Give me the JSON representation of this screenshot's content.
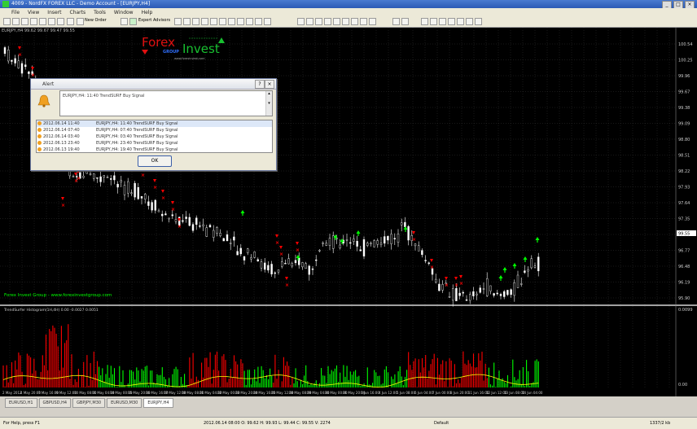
{
  "window": {
    "title": "4009 - NordFX FOREX LLC - Demo Account - [EURJPY,H4]"
  },
  "menu": [
    "File",
    "View",
    "Insert",
    "Charts",
    "Tools",
    "Window",
    "Help"
  ],
  "toolbar": {
    "new_order": "New Order",
    "expert_advisors": "Expert Advisors"
  },
  "chart": {
    "window_label": "EURJPY,H4  99.62 99.67 99.47 99.55",
    "price_ticks": [
      "100.54",
      "100.25",
      "99.96",
      "99.67",
      "99.38",
      "99.09",
      "98.80",
      "98.51",
      "98.22",
      "97.93",
      "97.64",
      "97.35",
      "97.06",
      "96.77",
      "96.48",
      "96.19",
      "95.90"
    ],
    "current_price": "99.55",
    "overlay_note": "Forex Invest Group - www.forexinvestgroup.com",
    "indicator_label": "TrendSurfer Histogram(1H,4H)  0.00  -0.0027  0.0051",
    "indicator_ticks": [
      "0.0099",
      "0.00"
    ],
    "time_labels": [
      "2 May 2012",
      "4 May 20:00",
      "7 May 16:00",
      "9 May 12:00",
      "10 May 08:00",
      "11 May 04:00",
      "14 May 00:00",
      "15 May 20:00",
      "16 May 16:00",
      "17 May 12:00",
      "18 May 08:00",
      "21 May 04:00",
      "22 May 00:00",
      "23 May 20:00",
      "24 May 16:00",
      "25 May 12:00",
      "28 May 08:00",
      "29 May 04:00",
      "30 May 00:00",
      "31 May 20:00",
      "1 Jun 16:00",
      "4 Jun 12:00",
      "5 Jun 08:00",
      "6 Jun 04:00",
      "7 Jun 00:00",
      "8 Jun 20:00",
      "11 Jun 16:00",
      "12 Jun 12:00",
      "13 Jun 08:00",
      "14 Jun 04:00"
    ]
  },
  "logo": {
    "word1": "Forex",
    "word2": "Invest",
    "word3": "GROUP",
    "site": "www.forexinvest.com"
  },
  "alert": {
    "title": "Alert",
    "message": "EURJPY,H4: 11:40 TrendSURF Buy Signal",
    "rows": [
      {
        "date": "2012.06.14 11:40",
        "msg": "EURJPY,H4: 11:40 TrendSURF Buy Signal"
      },
      {
        "date": "2012.06.14 07:40",
        "msg": "EURJPY,H4: 07:40 TrendSURF Buy Signal"
      },
      {
        "date": "2012.06.14 03:40",
        "msg": "EURJPY,H4: 03:40 TrendSURF Buy Signal"
      },
      {
        "date": "2012.06.13 23:40",
        "msg": "EURJPY,H4: 23:40 TrendSURF Buy Signal"
      },
      {
        "date": "2012.06.13 19:40",
        "msg": "EURJPY,H4: 19:40 TrendSURF Buy Signal"
      }
    ],
    "ok": "OK"
  },
  "tabs": [
    "EURUSD,H1",
    "GBPUSD,H4",
    "GBPJPY,M30",
    "EURUSD,M30",
    "EURJPY,H4"
  ],
  "status": {
    "help": "For Help, press F1",
    "bar_info": "2012.06.14 08:00  O: 99.62  H: 99.93  L: 99.44  C: 99.55  V: 2274",
    "profile": "Default",
    "connection": "1337/2 kb"
  },
  "colors": {
    "bull": "#00ff00",
    "bear": "#ff0000",
    "candle": "#ffffff",
    "background": "#000000",
    "yellow_line": "#ffff00"
  }
}
